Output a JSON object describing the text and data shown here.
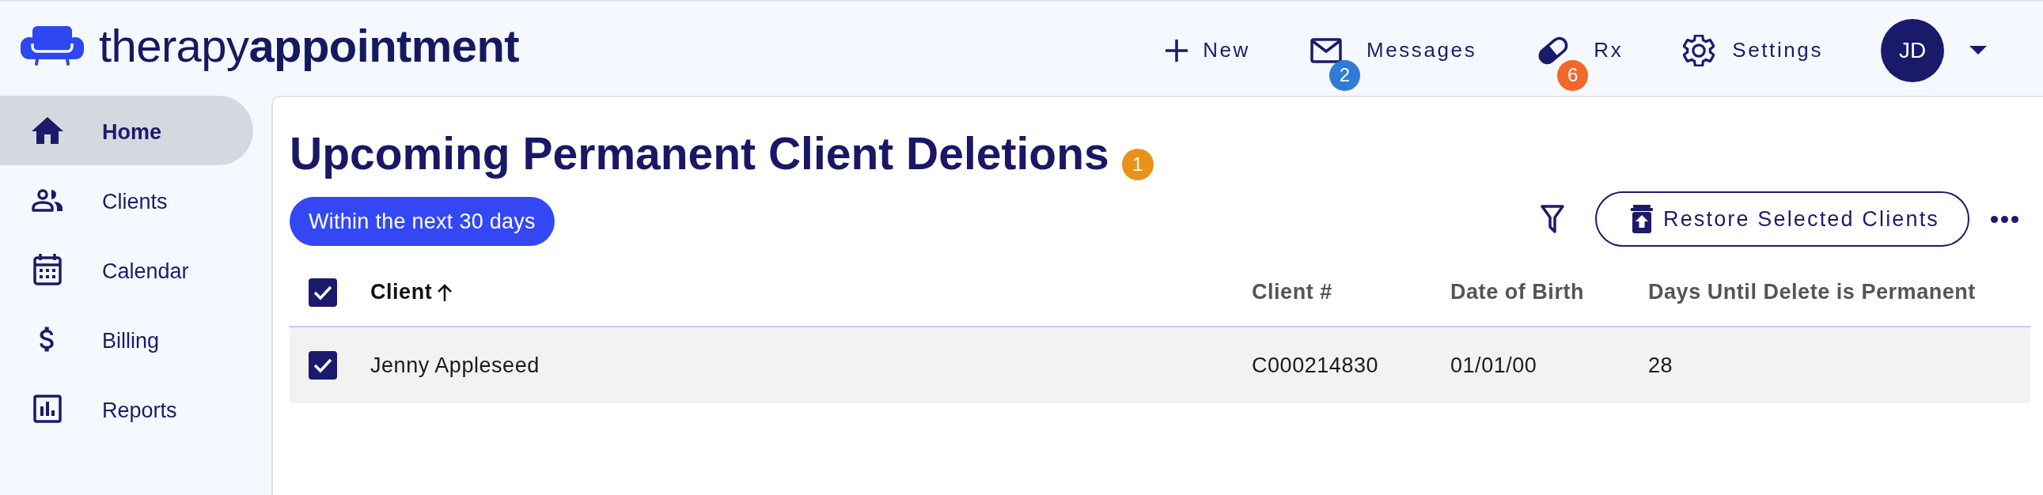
{
  "header": {
    "logo": "therapy**appointment**",
    "nav": [
      {
        "label": "New"
      },
      {
        "label": "Messages",
        "badge": {
          "text": "2",
          "color": "#2f7bd8"
        }
      },
      {
        "label": "Rx",
        "badge": {
          "text": "6",
          "color": "#f2682a"
        }
      },
      {
        "label": "Settings"
      }
    ],
    "user": {
      "initials": "JD"
    }
  },
  "sidebar": {
    "items": [
      {
        "label": "Home",
        "selected": true
      },
      {
        "label": "Clients",
        "selected": false
      },
      {
        "label": "Calendar",
        "selected": false
      },
      {
        "label": "Billing",
        "selected": false
      },
      {
        "label": "Reports",
        "selected": false
      }
    ]
  },
  "page": {
    "title": "Upcoming Permanent Client Deletions",
    "count_badge": "1",
    "filter_chip": "Within the next 30 days",
    "restore_button": "Restore Selected Clients"
  },
  "table": {
    "select_all_checked": true,
    "columns": [
      {
        "label": "Client",
        "sorted": true
      },
      {
        "label": "Client #",
        "sorted": false
      },
      {
        "label": "Date of Birth",
        "sorted": false
      },
      {
        "label": "Days Until Delete is Permanent",
        "sorted": false
      }
    ],
    "rows": [
      {
        "selected": true,
        "cells": [
          "Jenny Appleseed",
          "C000214830",
          "01/01/00",
          "28"
        ]
      }
    ]
  }
}
